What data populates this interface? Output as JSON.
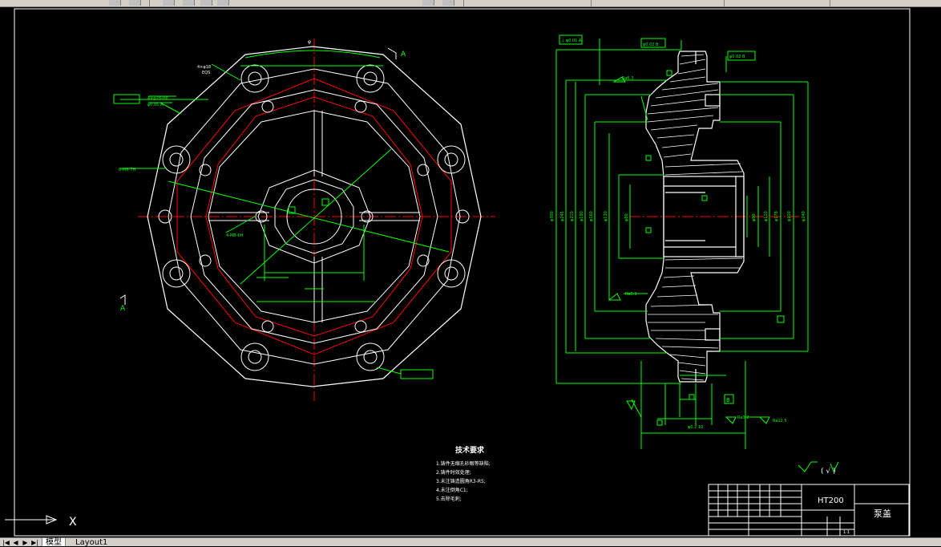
{
  "tabs": {
    "model": "模型",
    "layout1": "Layout1"
  },
  "tech_notes": {
    "title": "技术要求",
    "items": [
      "1.铸件无缩孔砂眼等缺陷;",
      "2.铸件时效处理;",
      "3.未注铸造圆角R3-R5;",
      "4.未注倒角C1;",
      "5.去除毛刺;"
    ]
  },
  "roughness_note": "(  √  )",
  "title_block": {
    "material": "HT200",
    "part_name": "泵盖",
    "scale": "1:1"
  },
  "labels": {
    "view_a_left": "A",
    "view_a_right": "A",
    "section_b": "B",
    "ucs_x": "X"
  },
  "colors": {
    "geometry": "#ffffff",
    "dimension": "#00ff00",
    "center": "#ff0000",
    "background": "#000000"
  }
}
